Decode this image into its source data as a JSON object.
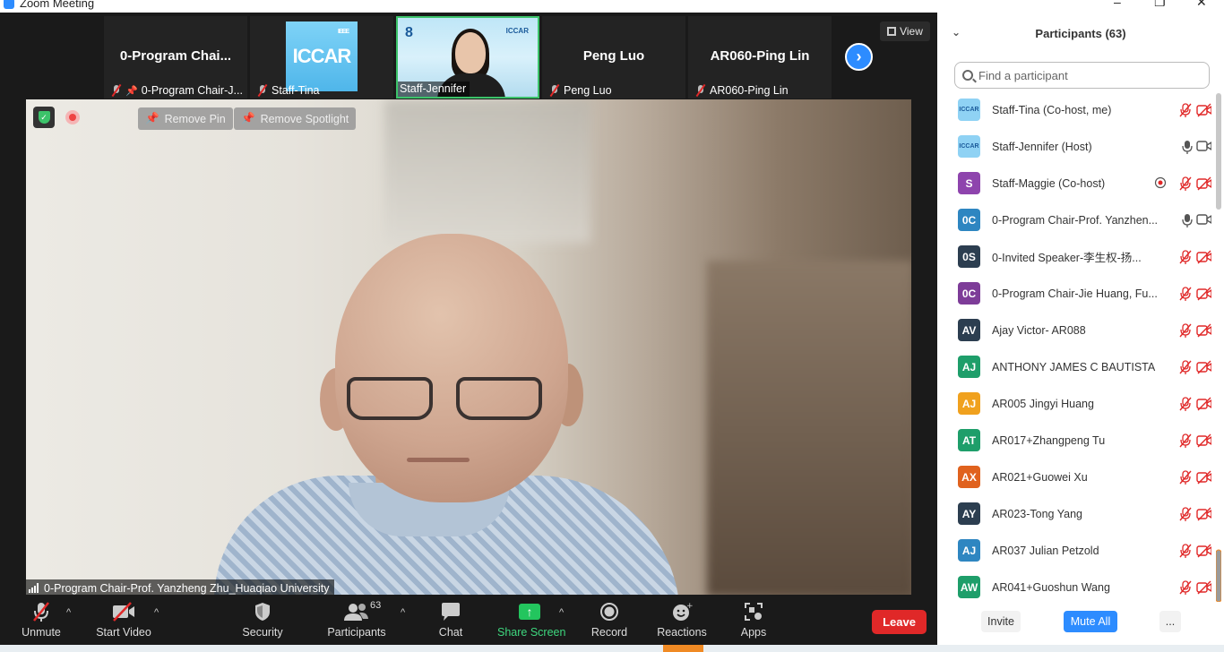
{
  "window": {
    "title": "Zoom Meeting",
    "controls": [
      "–",
      "❐",
      "✕"
    ]
  },
  "thumbnails": [
    {
      "name": "0-Program  Chai...",
      "caption": "0-Program Chair-J...",
      "muted": true,
      "pinned": true,
      "type": "name"
    },
    {
      "name": "ICCAR",
      "caption": "Staff-Tina",
      "muted": true,
      "type": "logo"
    },
    {
      "name": "Staff-Jennifer",
      "caption": "Staff-Jennifer",
      "muted": false,
      "type": "video"
    },
    {
      "name": "Peng Luo",
      "caption": "Peng Luo",
      "muted": true,
      "type": "name"
    },
    {
      "name": "AR060-Ping Lin",
      "caption": "AR060-Ping Lin",
      "muted": true,
      "type": "name"
    }
  ],
  "view_button": "View",
  "main_video": {
    "remove_pin": "Remove Pin",
    "remove_spotlight": "Remove Spotlight",
    "speaker": "0-Program Chair-Prof. Yanzheng Zhu_Huaqiao University"
  },
  "toolbar": {
    "unmute": "Unmute",
    "start_video": "Start Video",
    "security": "Security",
    "participants": "Participants",
    "participants_count": "63",
    "chat": "Chat",
    "share_screen": "Share Screen",
    "record": "Record",
    "reactions": "Reactions",
    "apps": "Apps",
    "leave": "Leave"
  },
  "panel": {
    "title": "Participants (63)",
    "search_placeholder": "Find a participant",
    "invite": "Invite",
    "mute_all": "Mute All",
    "more": "..."
  },
  "participants": [
    {
      "initials": "ICCAR",
      "name": "Staff-Tina (Co-host, me)",
      "color": "#8fd2f4",
      "logo": true,
      "mic": "muted",
      "cam": "off"
    },
    {
      "initials": "ICCAR",
      "name": "Staff-Jennifer (Host)",
      "color": "#8fd2f4",
      "logo": true,
      "mic": "on",
      "cam": "on"
    },
    {
      "initials": "S",
      "name": "Staff-Maggie (Co-host)",
      "color": "#8e44ad",
      "mic": "muted",
      "cam": "off",
      "extra": "record"
    },
    {
      "initials": "0C",
      "name": "0-Program Chair-Prof. Yanzhen...",
      "color": "#2e86c1",
      "mic": "on",
      "cam": "on"
    },
    {
      "initials": "0S",
      "name": "0-Invited Speaker-李生权-扬...",
      "color": "#2c3e50",
      "mic": "muted",
      "cam": "off"
    },
    {
      "initials": "0C",
      "name": "0-Program Chair-Jie Huang, Fu...",
      "color": "#7d3c98",
      "mic": "muted",
      "cam": "off"
    },
    {
      "initials": "AV",
      "name": "Ajay Victor- AR088",
      "color": "#2c3e50",
      "mic": "muted",
      "cam": "off"
    },
    {
      "initials": "AJ",
      "name": "ANTHONY JAMES C BAUTISTA",
      "color": "#1e9e6a",
      "mic": "muted",
      "cam": "off"
    },
    {
      "initials": "AJ",
      "name": "AR005 Jingyi Huang",
      "color": "#f0a11e",
      "mic": "muted",
      "cam": "off"
    },
    {
      "initials": "AT",
      "name": "AR017+Zhangpeng Tu",
      "color": "#1e9e6a",
      "mic": "muted",
      "cam": "off"
    },
    {
      "initials": "AX",
      "name": "AR021+Guowei Xu",
      "color": "#e0621e",
      "mic": "muted",
      "cam": "off"
    },
    {
      "initials": "AY",
      "name": "AR023-Tong Yang",
      "color": "#2c3e50",
      "mic": "muted",
      "cam": "off"
    },
    {
      "initials": "AJ",
      "name": "AR037 Julian Petzold",
      "color": "#2e86c1",
      "mic": "muted",
      "cam": "off"
    },
    {
      "initials": "AW",
      "name": "AR041+Guoshun Wang",
      "color": "#1e9e6a",
      "mic": "muted",
      "cam": "off"
    }
  ]
}
